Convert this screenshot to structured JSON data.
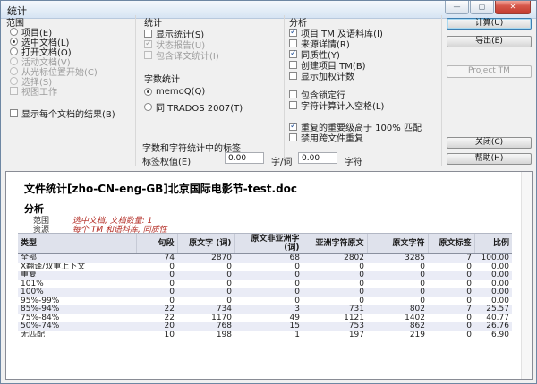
{
  "window": {
    "title": "统计",
    "controls": {
      "minimize": "—",
      "maximize": "▢",
      "close": "✕"
    }
  },
  "scope": {
    "label": "范围",
    "options": [
      {
        "type": "radio",
        "label": "项目(E)",
        "checked": false,
        "disabled": false
      },
      {
        "type": "radio",
        "label": "选中文档(L)",
        "checked": true,
        "disabled": false
      },
      {
        "type": "radio",
        "label": "打开文档(O)",
        "checked": false,
        "disabled": false
      },
      {
        "type": "radio",
        "label": "活动文档(V)",
        "checked": false,
        "disabled": true
      },
      {
        "type": "radio",
        "label": "从光标位置开始(C)",
        "checked": false,
        "disabled": true
      },
      {
        "type": "radio",
        "label": "选择(S)",
        "checked": false,
        "disabled": true
      },
      {
        "type": "checkbox",
        "label": "视图工作",
        "checked": false,
        "disabled": true
      }
    ],
    "show_results_checkbox": {
      "type": "checkbox",
      "label": "显示每个文档的结果(B)",
      "checked": false,
      "disabled": false
    }
  },
  "statistics": {
    "label": "统计",
    "checkboxes": [
      {
        "type": "checkbox",
        "label": "显示统计(S)",
        "checked": false,
        "disabled": false
      },
      {
        "type": "checkbox",
        "label": "状态报告(U)",
        "checked": true,
        "disabled": true
      },
      {
        "type": "checkbox",
        "label": "包含译文统计(I)",
        "checked": false,
        "disabled": true
      }
    ]
  },
  "wordcount": {
    "label": "字数统计",
    "options": [
      {
        "type": "radio",
        "label": "memoQ(Q)",
        "checked": true,
        "disabled": false
      },
      {
        "type": "radio",
        "label": "同 TRADOS 2007(T)",
        "checked": false,
        "disabled": false
      }
    ]
  },
  "analysis": {
    "label": "分析",
    "checkboxes_a": [
      {
        "type": "checkbox",
        "label": "项目 TM 及语料库(I)",
        "checked": true,
        "disabled": false
      },
      {
        "type": "checkbox",
        "label": "来源详情(R)",
        "checked": false,
        "disabled": false
      },
      {
        "type": "checkbox",
        "label": "同质性(Y)",
        "checked": true,
        "disabled": false
      },
      {
        "type": "checkbox",
        "label": "创建项目 TM(B)",
        "checked": false,
        "disabled": false
      },
      {
        "type": "checkbox",
        "label": "显示加权计数",
        "checked": false,
        "disabled": false
      }
    ],
    "checkboxes_b": [
      {
        "type": "checkbox",
        "label": "包含锁定行",
        "checked": false,
        "disabled": false
      },
      {
        "type": "checkbox",
        "label": "字符计算计入空格(L)",
        "checked": false,
        "disabled": false
      }
    ],
    "checkboxes_c": [
      {
        "type": "checkbox",
        "label": "重复的重要级高于 100% 匹配",
        "checked": true,
        "disabled": false
      },
      {
        "type": "checkbox",
        "label": "禁用跨文件重复",
        "checked": false,
        "disabled": false
      }
    ]
  },
  "tags": {
    "label": "字数和字符统计中的标签",
    "weight_label": "标签权值(E)",
    "word_value": "0.00",
    "word_unit": "字/词",
    "char_value": "0.00",
    "char_unit": "字符"
  },
  "buttons": {
    "calculate": "计算(U)",
    "export": "导出(E)",
    "project_tm": "Project TM",
    "close": "关闭(C)",
    "help": "帮助(H)"
  },
  "report": {
    "title": "文件统计[zho-CN-eng-GB]北京国际电影节-test.doc",
    "section": "分析",
    "meta": [
      {
        "label": "范围",
        "value": "选中文档, 文档数量: 1"
      },
      {
        "label": "资源",
        "value": "每个 TM 和语料库, 同质性"
      }
    ]
  },
  "chart_data": {
    "type": "table",
    "columns": [
      "类型",
      "句段",
      "原文字 (词)",
      "原文非亚洲字 (词)",
      "亚洲字符原文",
      "原文字符",
      "原文标签",
      "比例"
    ],
    "rows": [
      [
        "全部",
        "74",
        "2870",
        "68",
        "2802",
        "3285",
        "7",
        "100.00"
      ],
      [
        "X翻译/双重上下文",
        "0",
        "0",
        "0",
        "0",
        "0",
        "0",
        "0.00"
      ],
      [
        "重复",
        "0",
        "0",
        "0",
        "0",
        "0",
        "0",
        "0.00"
      ],
      [
        "101%",
        "0",
        "0",
        "0",
        "0",
        "0",
        "0",
        "0.00"
      ],
      [
        "100%",
        "0",
        "0",
        "0",
        "0",
        "0",
        "0",
        "0.00"
      ],
      [
        "95%-99%",
        "0",
        "0",
        "0",
        "0",
        "0",
        "0",
        "0.00"
      ],
      [
        "85%-94%",
        "22",
        "734",
        "3",
        "731",
        "802",
        "7",
        "25.57"
      ],
      [
        "75%-84%",
        "22",
        "1170",
        "49",
        "1121",
        "1402",
        "0",
        "40.77"
      ],
      [
        "50%-74%",
        "20",
        "768",
        "15",
        "753",
        "862",
        "0",
        "26.76"
      ],
      [
        "无匹配",
        "10",
        "198",
        "1",
        "197",
        "219",
        "0",
        "6.90"
      ]
    ]
  }
}
